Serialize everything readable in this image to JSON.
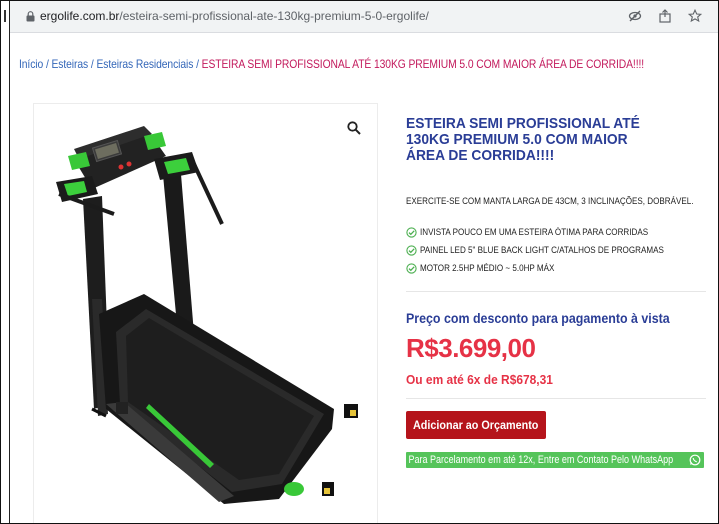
{
  "browser": {
    "url_host": "ergolife.com.br",
    "url_path": "/esteira-semi-profissional-ate-130kg-premium-5-0-ergolife/",
    "icons": [
      "lock-icon",
      "eye-slash-icon",
      "share-icon",
      "star-icon"
    ]
  },
  "breadcrumb": {
    "items": [
      "Início",
      "Esteiras",
      "Esteiras Residenciais"
    ],
    "separator": " / ",
    "current": "ESTEIRA SEMI PROFISSIONAL ATÉ 130KG PREMIUM 5.0 COM MAIOR ÁREA DE CORRIDA!!!!"
  },
  "product": {
    "title": "ESTEIRA SEMI PROFISSIONAL ATÉ 130KG PREMIUM 5.0 COM MAIOR ÁREA DE CORRIDA!!!!",
    "description": "EXERCITE-SE COM MANTA LARGA DE 43CM, 3 INCLINAÇÕES, DOBRÁVEL.",
    "features": [
      "INVISTA POUCO EM UMA ESTEIRA ÓTIMA PARA CORRIDAS",
      "PAINEL LED 5\" BLUE BACK LIGHT C/ATALHOS DE PROGRAMAS",
      "MOTOR 2.5HP MÉDIO ~ 5.0HP MÁX"
    ],
    "price_label": "Preço com desconto para pagamento à vista",
    "price": "R$3.699,00",
    "installments": "Ou em até 6x de R$678,31",
    "add_button": "Adicionar ao Orçamento",
    "whatsapp_button": "Para Parcelamento em até 12x, Entre em Contato Pelo WhatsApp"
  },
  "colors": {
    "title_blue": "#2a3d96",
    "price_red": "#e63246",
    "button_red": "#b5141b",
    "whatsapp_green": "#55c45a",
    "check_green": "#4caf50",
    "breadcrumb_link": "#3366b8",
    "breadcrumb_current": "#c2185b"
  }
}
